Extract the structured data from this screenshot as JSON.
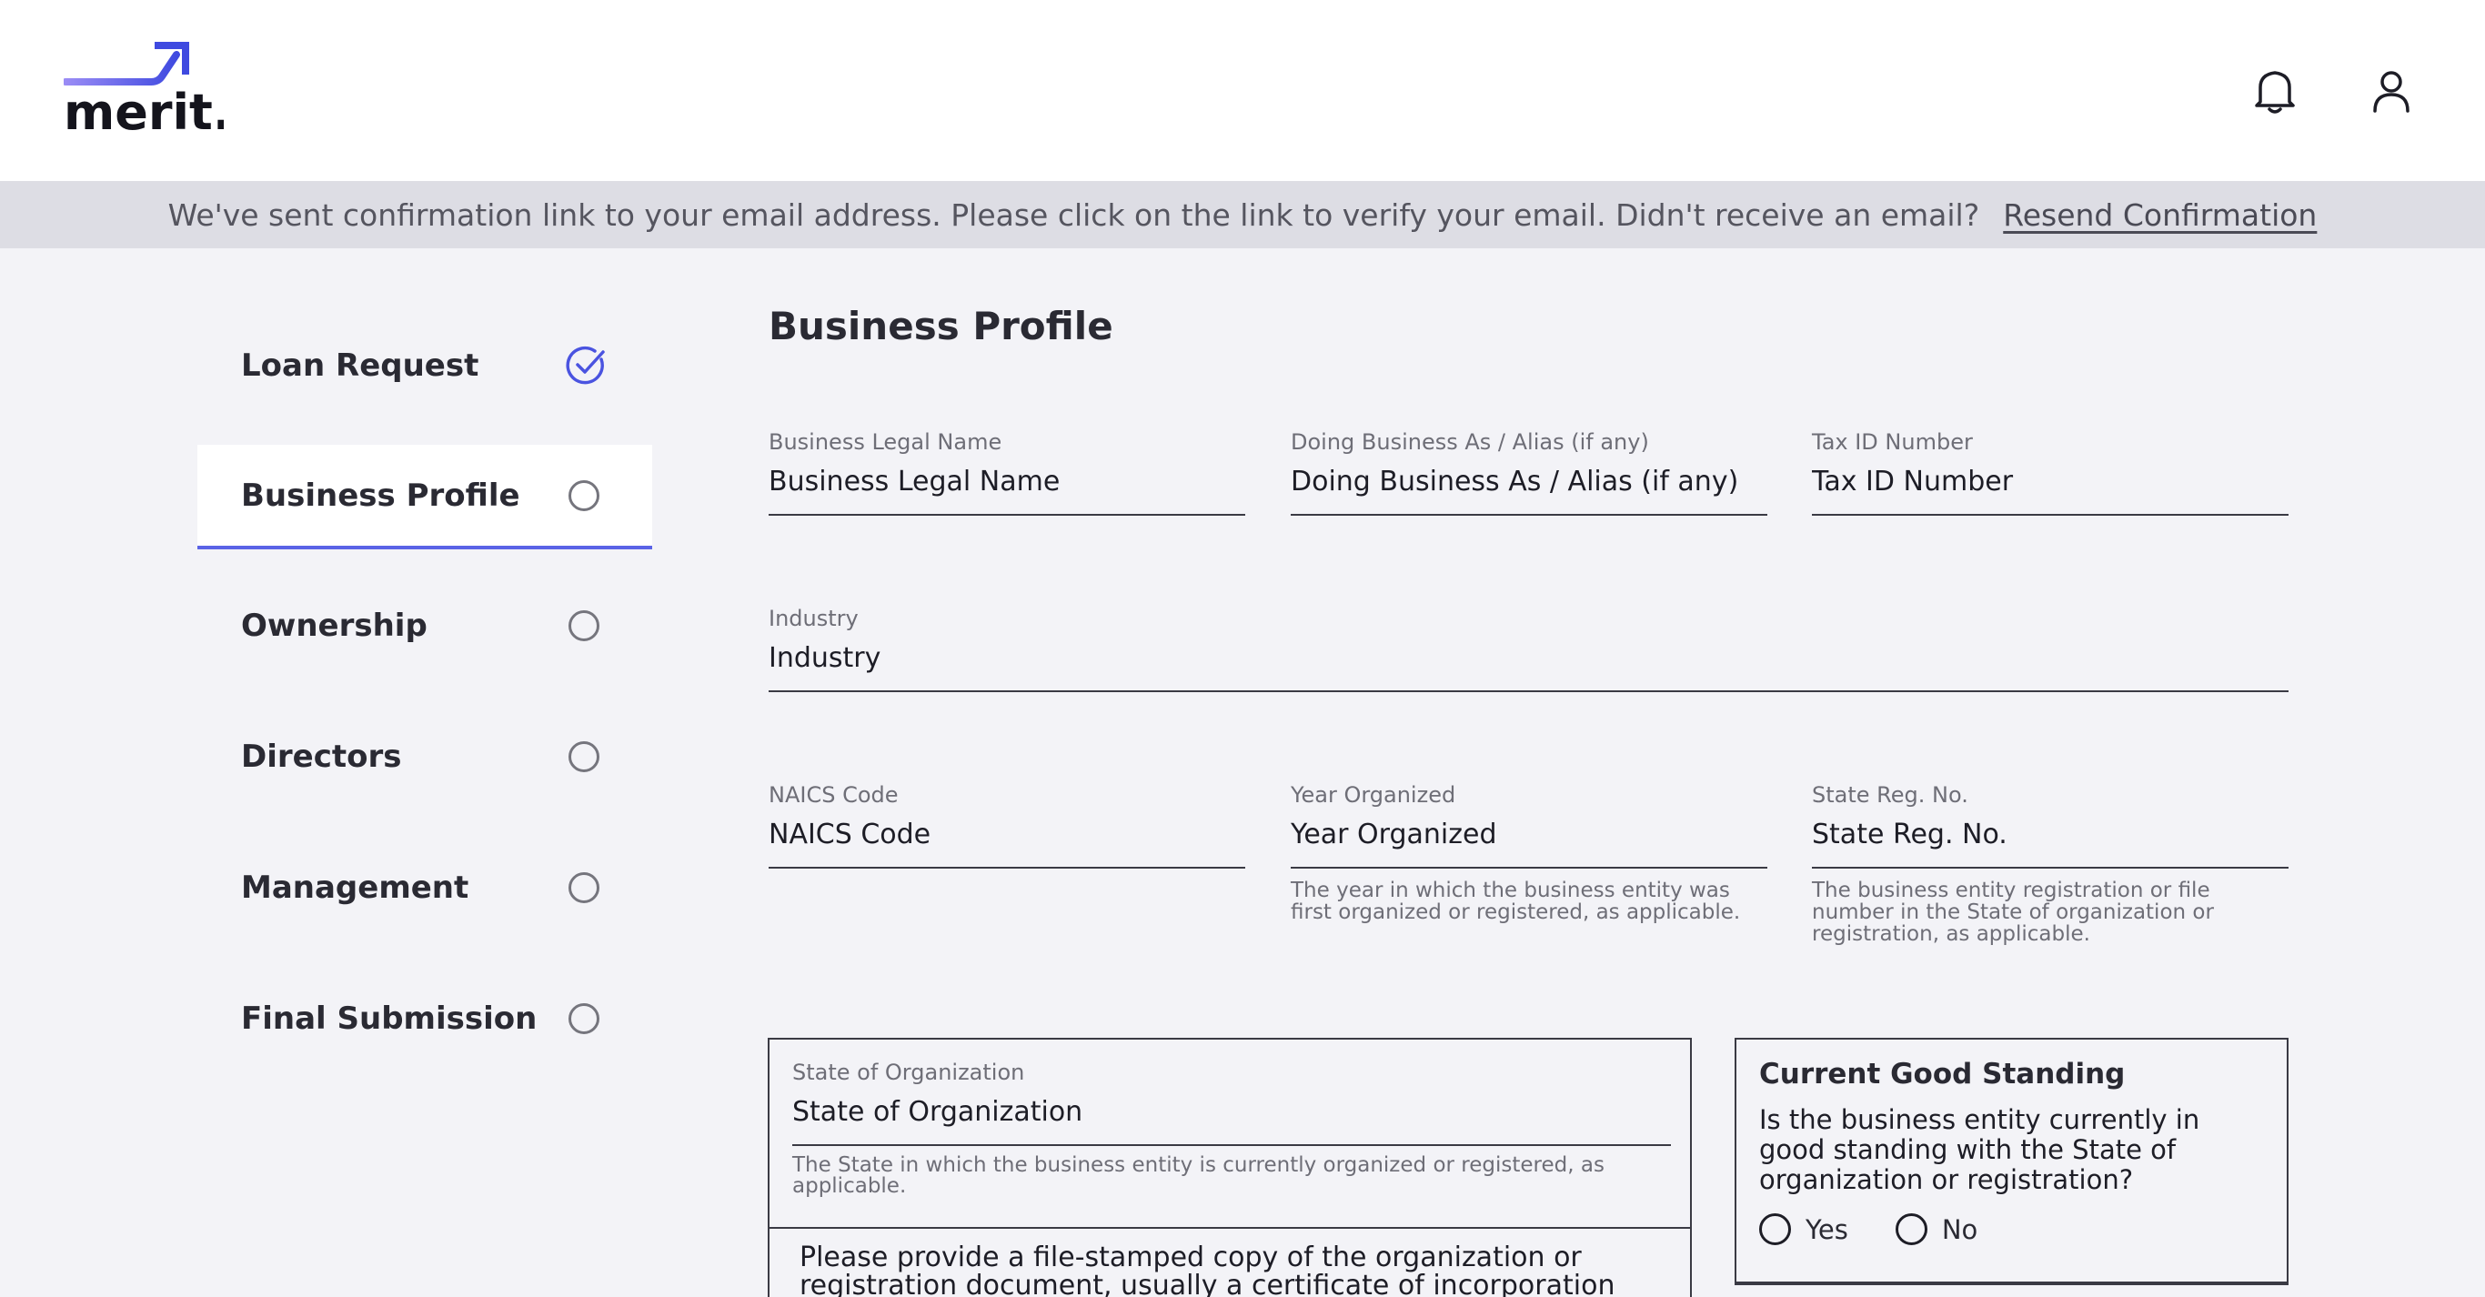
{
  "logo": {
    "text": "merit."
  },
  "header": {
    "notification_icon": "bell-icon",
    "profile_icon": "user-icon"
  },
  "banner": {
    "message": "We've sent confirmation link to your email address. Please click on the link to verify your email. Didn't receive an email?",
    "resend_label": "Resend Confirmation"
  },
  "sidebar": {
    "items": [
      {
        "label": "Loan Request",
        "status": "complete"
      },
      {
        "label": "Business Profile",
        "status": "active"
      },
      {
        "label": "Ownership",
        "status": "pending"
      },
      {
        "label": "Directors",
        "status": "pending"
      },
      {
        "label": "Management",
        "status": "pending"
      },
      {
        "label": "Final Submission",
        "status": "pending"
      }
    ]
  },
  "main": {
    "title": "Business Profile",
    "fields": {
      "legal_name": {
        "label": "Business Legal Name",
        "placeholder": "Business Legal Name"
      },
      "dba": {
        "label": "Doing Business As / Alias (if any)",
        "placeholder": "Doing Business As / Alias (if any)"
      },
      "tax_id": {
        "label": "Tax ID Number",
        "placeholder": "Tax ID Number"
      },
      "industry": {
        "label": "Industry",
        "placeholder": "Industry"
      },
      "naics": {
        "label": "NAICS Code",
        "placeholder": "NAICS Code"
      },
      "year": {
        "label": "Year Organized",
        "placeholder": "Year Organized",
        "help": "The year in which the business entity was first organized or registered, as applicable."
      },
      "state_reg": {
        "label": "State Reg. No.",
        "placeholder": "State Reg. No.",
        "help": "The business entity registration or file number in the State of organization or registration, as applicable."
      },
      "state_org": {
        "label": "State of Organization",
        "placeholder": "State of Organization",
        "help": "The State in which the business entity is currently organized or registered, as applicable."
      }
    },
    "upload_text": "Please provide a file-stamped copy of the organization or registration document, usually a certificate of incorporation (for",
    "good_standing": {
      "title": "Current Good Standing",
      "question": "Is the business entity currently in good standing with the State of organization or registration?",
      "yes_label": "Yes",
      "no_label": "No"
    }
  },
  "colors": {
    "accent": "#5a63e6",
    "background": "#f3f3f7",
    "banner": "#dddde4"
  }
}
